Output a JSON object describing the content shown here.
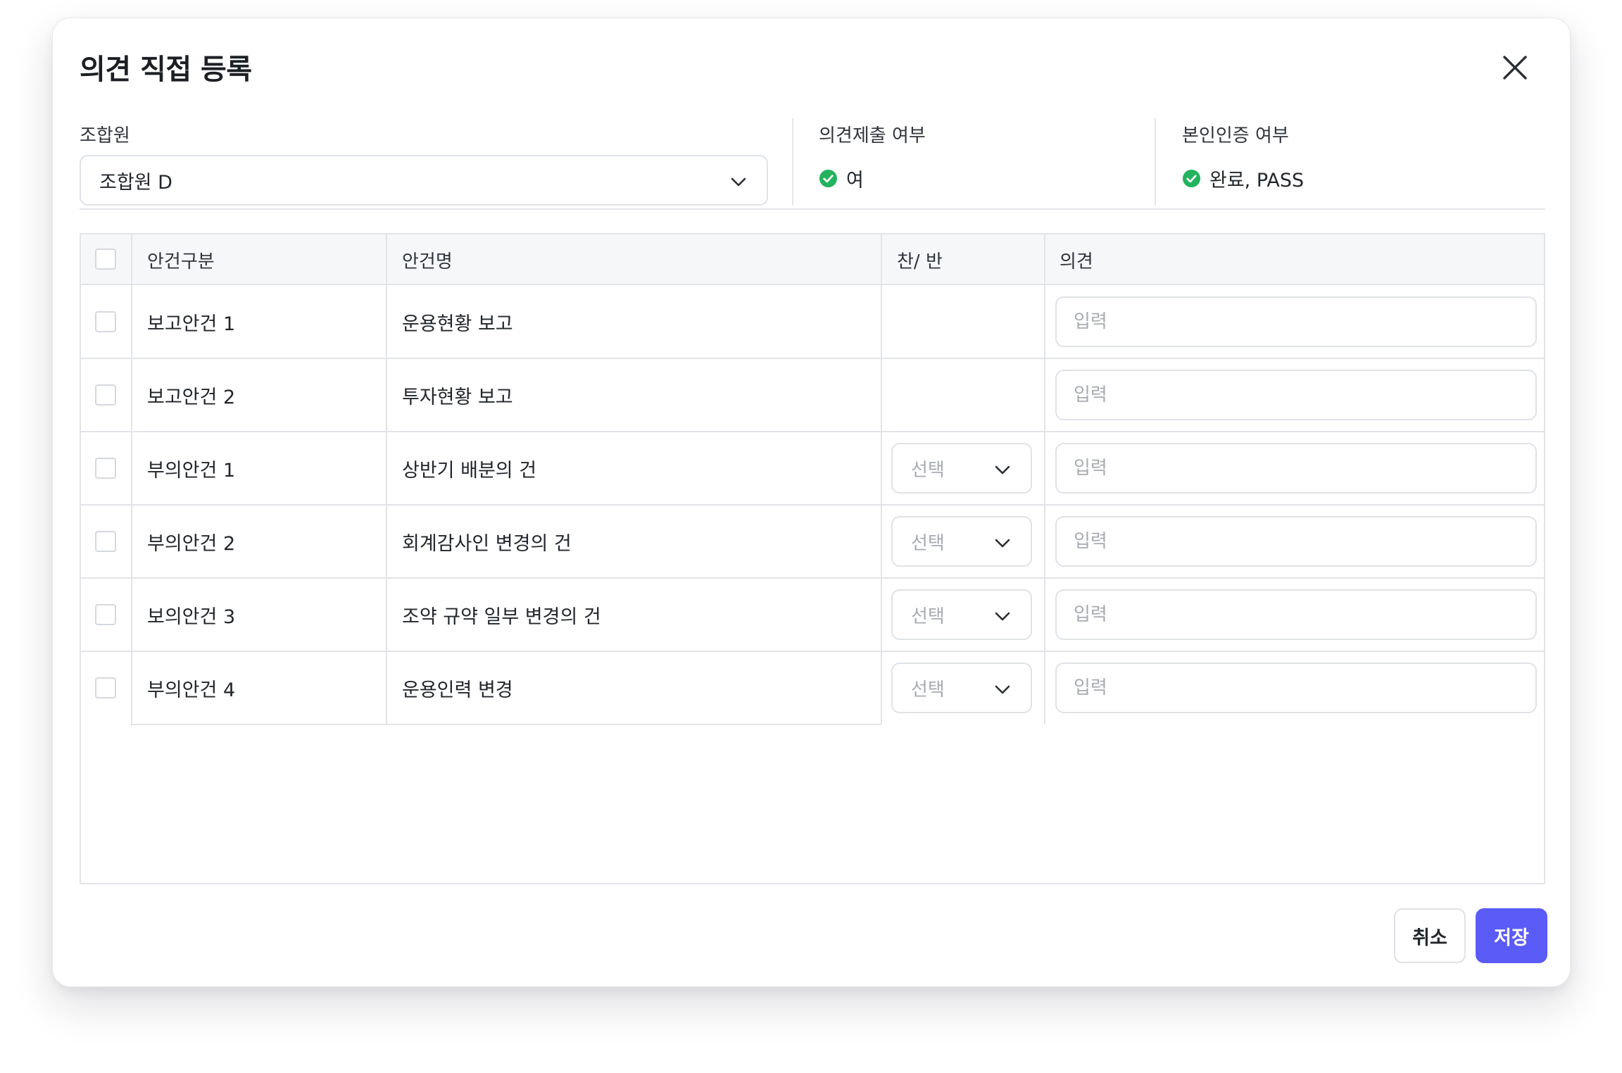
{
  "modal": {
    "title": "의견 직접 등록",
    "close_icon": "close-icon"
  },
  "member": {
    "label": "조합원",
    "selected": "조합원 D"
  },
  "submission": {
    "label": "의견제출 여부",
    "value": "여",
    "status_color": "#22b35e"
  },
  "verification": {
    "label": "본인인증 여부",
    "value": "완료, PASS",
    "status_color": "#22b35e"
  },
  "table": {
    "headers": {
      "category": "안건구분",
      "name": "안건명",
      "vote": "찬/ 반",
      "opinion": "의견"
    },
    "rows": [
      {
        "category": "보고안건 1",
        "name": "운용현황 보고",
        "has_vote": false,
        "opinion_placeholder": "입력"
      },
      {
        "category": "보고안건 2",
        "name": "투자현황 보고",
        "has_vote": false,
        "opinion_placeholder": "입력"
      },
      {
        "category": "부의안건 1",
        "name": "상반기 배분의 건",
        "has_vote": true,
        "vote_placeholder": "선택",
        "opinion_placeholder": "입력"
      },
      {
        "category": "부의안건 2",
        "name": "회계감사인 변경의 건",
        "has_vote": true,
        "vote_placeholder": "선택",
        "opinion_placeholder": "입력"
      },
      {
        "category": "보의안건 3",
        "name": "조약 규약 일부 변경의 건",
        "has_vote": true,
        "vote_placeholder": "선택",
        "opinion_placeholder": "입력"
      },
      {
        "category": "부의안건 4",
        "name": "운용인력 변경",
        "has_vote": true,
        "vote_placeholder": "선택",
        "opinion_placeholder": "입력"
      }
    ]
  },
  "footer": {
    "cancel_label": "취소",
    "save_label": "저장",
    "accent_color": "#5b5bf7"
  }
}
